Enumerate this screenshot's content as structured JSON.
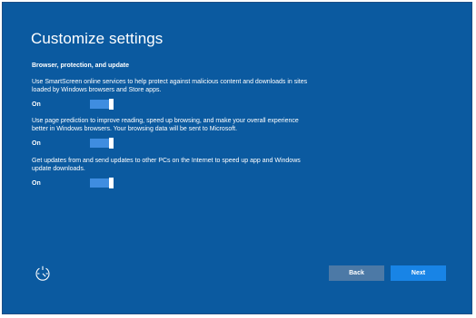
{
  "page": {
    "title": "Customize settings"
  },
  "section": {
    "heading": "Browser, protection, and update"
  },
  "settings": [
    {
      "desc_line1": "Use SmartScreen online services to help protect against malicious content and downloads in sites",
      "desc_line2": "loaded by Windows browsers and Store apps.",
      "state": "On",
      "enabled": true
    },
    {
      "desc_line1": "Use page prediction to improve reading, speed up browsing, and make your overall experience",
      "desc_line2": "better in Windows browsers. Your browsing data will be sent to Microsoft.",
      "state": "On",
      "enabled": true
    },
    {
      "desc_line1": "Get updates from and send updates to other PCs on the Internet to speed up app and Windows",
      "desc_line2": "update downloads.",
      "state": "On",
      "enabled": true
    }
  ],
  "footer": {
    "accessibility_icon": "ease-of-access-icon",
    "back_label": "Back",
    "next_label": "Next"
  },
  "colors": {
    "background": "#0b5aa0",
    "toggle_track": "#3f8de0",
    "back_button": "#4c79a6",
    "next_button": "#1884e6"
  }
}
